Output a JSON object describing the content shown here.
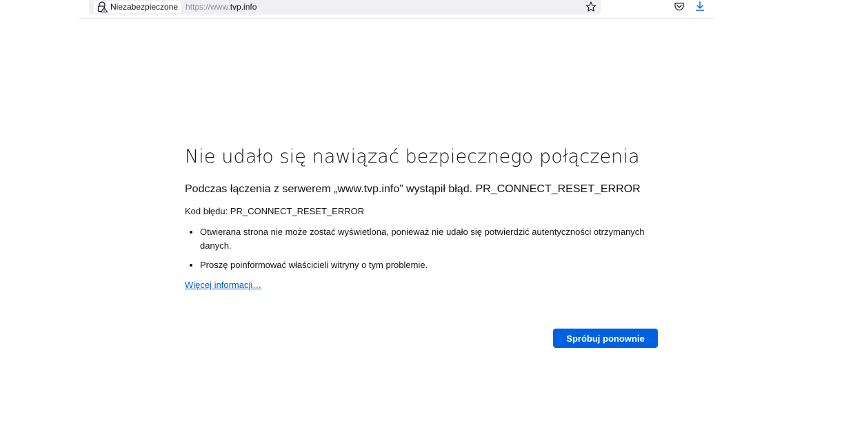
{
  "browser": {
    "security_label": "Niezabezpieczone",
    "url_prefix": "https://www.",
    "url_domain": "tvp.info",
    "icons": {
      "security": "lock-warning-icon",
      "bookmark": "star-icon",
      "pocket": "pocket-icon",
      "downloads": "download-icon"
    }
  },
  "error_page": {
    "title": "Nie udało się nawiązać bezpiecznego połączenia",
    "intro": "Podczas łączenia z serwerem „www.tvp.info” wystąpił błąd. PR_CONNECT_RESET_ERROR",
    "code_line": "Kod błędu: PR_CONNECT_RESET_ERROR",
    "reasons": [
      "Otwierana strona nie może zostać wyświetlona, ponieważ nie udało się potwierdzić autentyczności otrzymanych danych.",
      "Proszę poinformować właścicieli witryny o tym problemie."
    ],
    "learn_more": "Więcej informacji…",
    "retry_button": "Spróbuj ponownie"
  },
  "colors": {
    "accent": "#0061e0",
    "text": "#15141a",
    "muted": "#8f8f9d"
  }
}
